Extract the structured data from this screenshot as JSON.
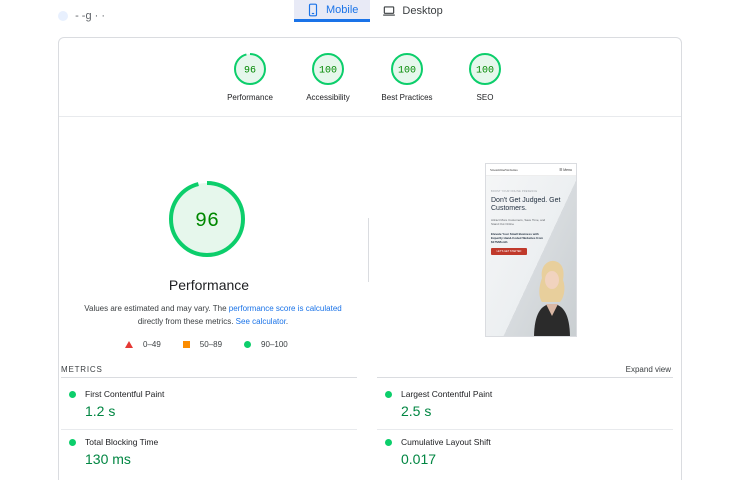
{
  "header": {
    "left_text": "- -g · ·",
    "tabs": [
      {
        "label": "Mobile",
        "icon": "smartphone-icon",
        "active": true
      },
      {
        "label": "Desktop",
        "icon": "laptop-icon",
        "active": false
      }
    ]
  },
  "scores": [
    {
      "value": "96",
      "label": "Performance",
      "score": 0.96
    },
    {
      "value": "100",
      "label": "Accessibility",
      "score": 1.0
    },
    {
      "value": "100",
      "label": "Best Practices",
      "score": 1.0
    },
    {
      "value": "100",
      "label": "SEO",
      "score": 1.0
    }
  ],
  "performance": {
    "value": "96",
    "score": 0.96,
    "title": "Performance",
    "desc_prefix": "Values are estimated and may vary. The ",
    "desc_link1": "performance score is calculated",
    "desc_mid": " directly from these metrics. ",
    "desc_link2": "See calculator",
    "desc_suffix": "."
  },
  "legend": {
    "poor": "0–49",
    "average": "50–89",
    "good": "90–100"
  },
  "preview": {
    "logo": "StreamlineWebsites",
    "menu": "☰ Menu",
    "kicker": "BOOST YOUR ONLINE PRESENCE",
    "headline": "Don't Get Judged. Get Customers.",
    "para1": "Attract More Customers, Save Time, and Stand Out Online",
    "para2": "Elevate Your Small Business with Expertly Hand-Coded Websites from $175/Month",
    "button": "LET'S GET STARTED"
  },
  "metrics": {
    "title": "METRICS",
    "expand": "Expand view",
    "items": [
      {
        "label": "First Contentful Paint",
        "value": "1.2 s"
      },
      {
        "label": "Largest Contentful Paint",
        "value": "2.5 s"
      },
      {
        "label": "Total Blocking Time",
        "value": "130 ms"
      },
      {
        "label": "Cumulative Layout Shift",
        "value": "0.017"
      }
    ]
  },
  "colors": {
    "good": "#0cce6b",
    "good_text": "#008800",
    "good_bg": "#e6f7ec",
    "average": "#fb8c00",
    "poor": "#e53935",
    "accent": "#1a73e8"
  }
}
